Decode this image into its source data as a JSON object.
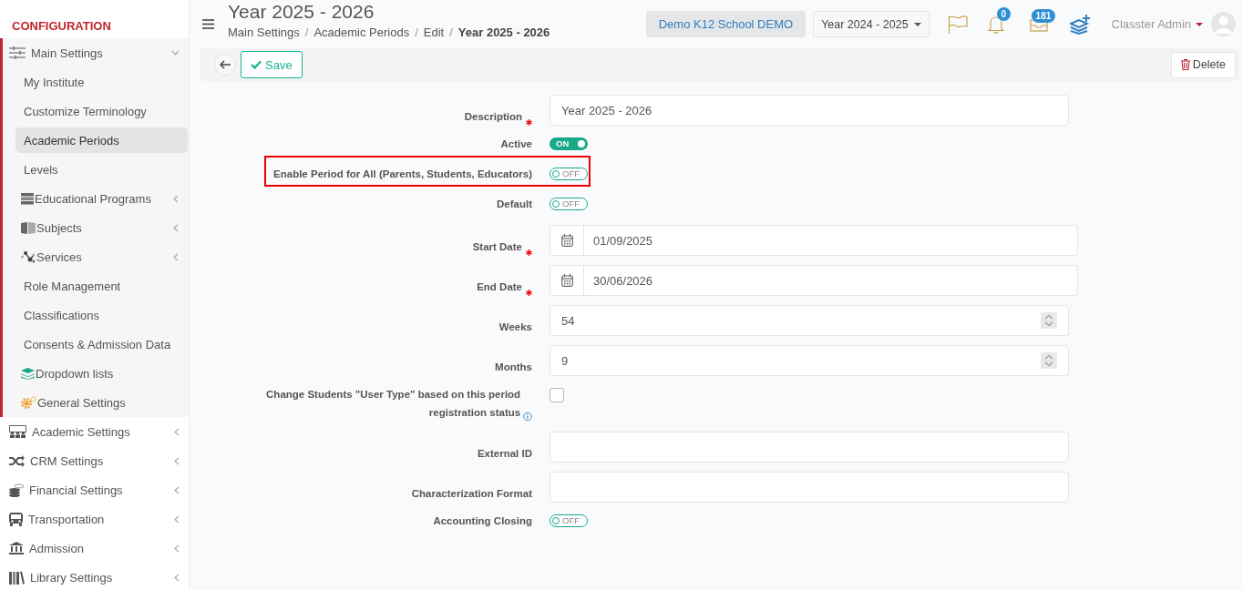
{
  "sidebar": {
    "heading": "CONFIGURATION",
    "items": [
      {
        "label": "Main Settings",
        "selected": false,
        "expanded": true,
        "children": [
          {
            "label": "My Institute",
            "selected": false
          },
          {
            "label": "Customize Terminology",
            "selected": false
          },
          {
            "label": "Academic Periods",
            "selected": true
          },
          {
            "label": "Levels",
            "selected": false
          },
          {
            "label": "Educational Programs",
            "selected": false,
            "expanded": false
          },
          {
            "label": "Subjects",
            "selected": false,
            "expanded": false
          },
          {
            "label": "Services",
            "selected": false,
            "expanded": false
          },
          {
            "label": "Role Management",
            "selected": false
          },
          {
            "label": "Classifications",
            "selected": false
          },
          {
            "label": "Consents & Admission Data",
            "selected": false
          },
          {
            "label": "Dropdown lists",
            "selected": false
          },
          {
            "label": "General Settings",
            "selected": false
          }
        ]
      },
      {
        "label": "Academic Settings",
        "selected": false,
        "expanded": false
      },
      {
        "label": "CRM Settings",
        "selected": false,
        "expanded": false
      },
      {
        "label": "Financial Settings",
        "selected": false,
        "expanded": false
      },
      {
        "label": "Transportation",
        "selected": false,
        "expanded": false
      },
      {
        "label": "Admission",
        "selected": false,
        "expanded": false
      },
      {
        "label": "Library Settings",
        "selected": false,
        "expanded": false
      }
    ]
  },
  "header": {
    "title": "Year 2025 - 2026",
    "breadcrumbs": [
      {
        "label": "Main Settings",
        "current": false,
        "separator": "/"
      },
      {
        "label": "Academic Periods",
        "current": false,
        "separator": "/"
      },
      {
        "label": "Edit",
        "current": false,
        "separator": "/"
      },
      {
        "label": "Year 2025 - 2026",
        "current": true
      }
    ],
    "school": "Demo K12 School DEMO",
    "year": "Year 2024 - 2025",
    "notifications": "0",
    "messages": "181",
    "user": "Classter Admin"
  },
  "toolbar": {
    "save": "Save",
    "delete": "Delete"
  },
  "form": {
    "fields": [
      {
        "kind": "text",
        "label": "Description",
        "required": true,
        "value": "Year 2025 - 2026"
      },
      {
        "kind": "switch",
        "label": "Active",
        "required": false,
        "on": true,
        "text": "ON"
      },
      {
        "kind": "switch",
        "label": "Enable Period for All (Parents, Students, Educators)",
        "required": false,
        "on": false,
        "text": "OFF",
        "highlighted": true
      },
      {
        "kind": "switch",
        "label": "Default",
        "required": false,
        "on": false,
        "text": "OFF"
      },
      {
        "kind": "date",
        "label": "Start Date",
        "required": true,
        "value": "01/09/2025"
      },
      {
        "kind": "date",
        "label": "End Date",
        "required": true,
        "value": "30/06/2026"
      },
      {
        "kind": "number",
        "label": "Weeks",
        "required": false,
        "value": "54"
      },
      {
        "kind": "number",
        "label": "Months",
        "required": false,
        "value": "9"
      },
      {
        "kind": "checkbox",
        "label": "Change Students \"User Type\" based on this period registration status",
        "required": false,
        "checked": false,
        "info": true
      },
      {
        "kind": "text",
        "label": "External ID",
        "required": false
      },
      {
        "kind": "text",
        "label": "Characterization Format",
        "required": false
      },
      {
        "kind": "switch",
        "label": "Accounting Closing",
        "required": false,
        "on": false,
        "text": "OFF"
      }
    ]
  }
}
